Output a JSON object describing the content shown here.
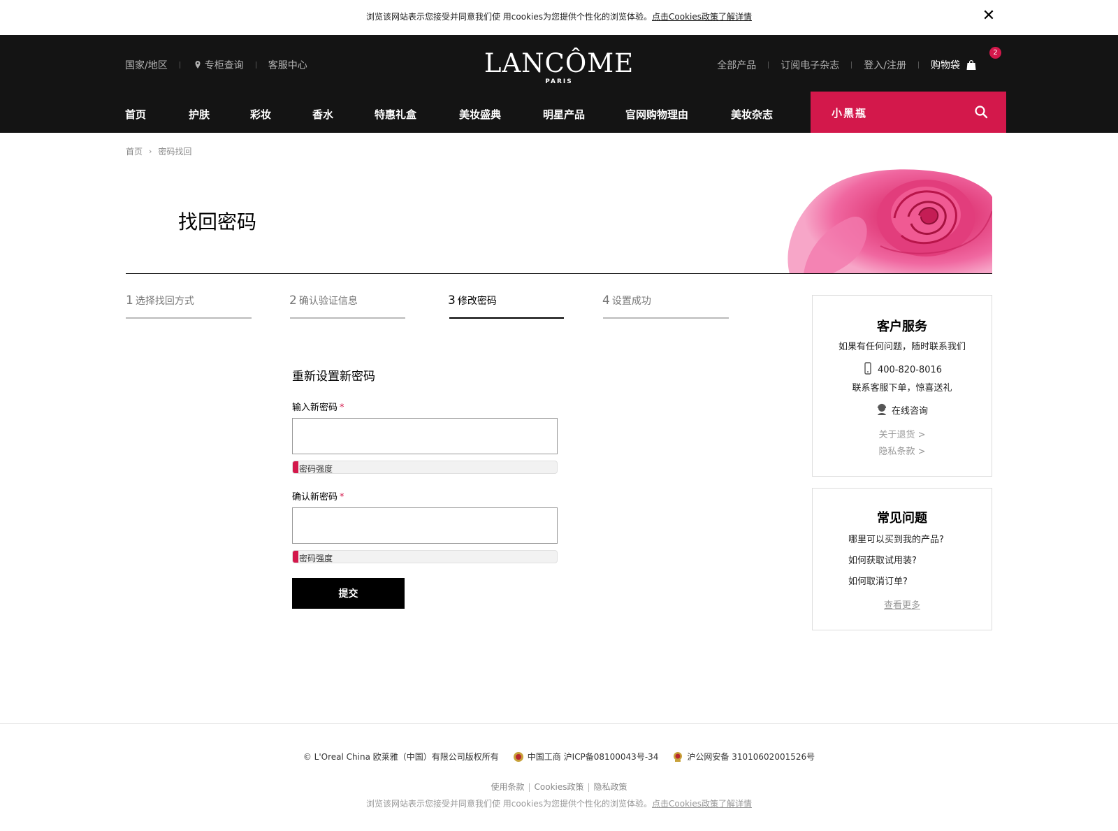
{
  "cookie_bar": {
    "text": "浏览该网站表示您接受并同意我们使 用cookies为您提供个性化的浏览体验。",
    "link": "点击Cookies政策了解详情",
    "close_icon": "close-icon"
  },
  "header": {
    "util_left": [
      "国家/地区",
      "专柜查询",
      "客服中心"
    ],
    "util_right": [
      "全部产品",
      "订阅电子杂志",
      "登入/注册"
    ],
    "cart_label": "购物袋",
    "cart_count": "2",
    "logo": {
      "brand": "LANCÔME",
      "sub": "PARIS"
    },
    "nav": [
      "首页",
      "护肤",
      "彩妆",
      "香水",
      "特惠礼盒",
      "美妆盛典",
      "明星产品",
      "官网购物理由",
      "美妆杂志"
    ],
    "search": {
      "value": "小黑瓶",
      "icon": "search-icon"
    },
    "colors": {
      "bg": "#141414",
      "accent": "#d3184b"
    }
  },
  "breadcrumb": [
    "首页",
    "密码找回"
  ],
  "page_title": "找回密码",
  "steps": [
    {
      "num": "1",
      "label": "选择找回方式",
      "active": false
    },
    {
      "num": "2",
      "label": "确认验证信息",
      "active": false
    },
    {
      "num": "3",
      "label": "修改密码",
      "active": true
    },
    {
      "num": "4",
      "label": "设置成功",
      "active": false
    }
  ],
  "form": {
    "title": "重新设置新密码",
    "new_password_label": "输入新密码",
    "confirm_password_label": "确认新密码",
    "required_mark": "*",
    "strength_label": "密码强度",
    "strength_level": 0.02,
    "submit_label": "提交"
  },
  "service_card": {
    "title": "客户服务",
    "subtitle": "如果有任何问题，随时联系我们",
    "phone": "400-820-8016",
    "phone_note": "联系客服下单，惊喜送礼",
    "online": "在线咨询",
    "return_link": "关于退货 >",
    "privacy_link": "隐私条款 >"
  },
  "faq_card": {
    "title": "常见问题",
    "items": [
      "哪里可以买到我的产品?",
      "如何获取试用装?",
      "如何取消订单?"
    ],
    "more": "查看更多"
  },
  "footer": {
    "copyright": "© L'Oreal China 欧莱雅（中国）有限公司版权所有",
    "icp": "中国工商 沪ICP备08100043号-34",
    "police": "沪公网安备 31010602001526号",
    "links": [
      "使用条款",
      "Cookies政策",
      "隐私政策"
    ],
    "cookie_text": "浏览该网站表示您接受并同意我们使 用cookies为您提供个性化的浏览体验。",
    "cookie_link": "点击Cookies政策了解详情"
  }
}
